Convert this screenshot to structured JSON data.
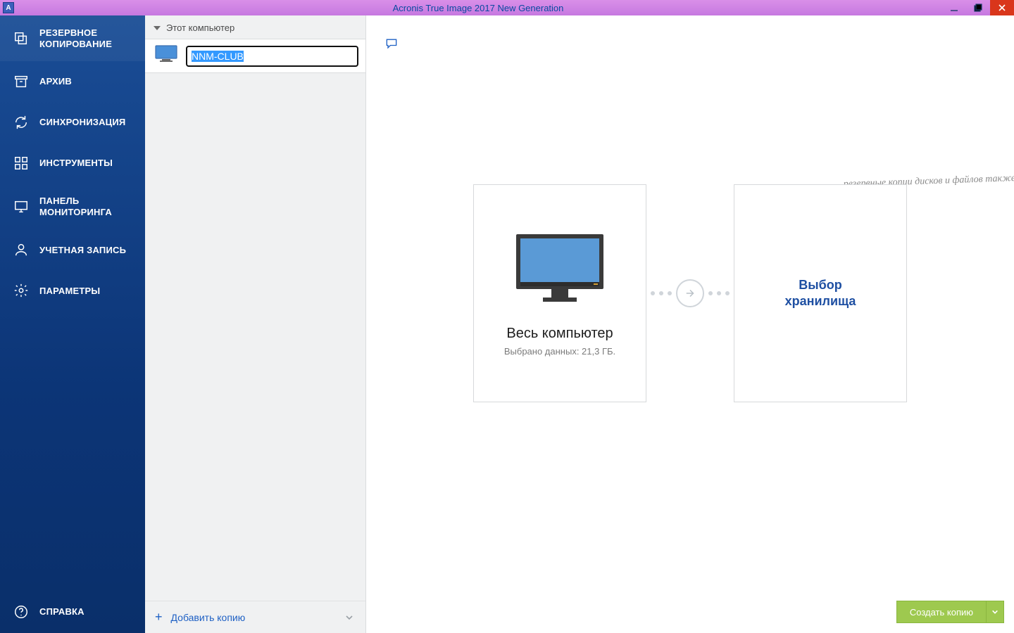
{
  "window": {
    "title": "Acronis True Image 2017 New Generation",
    "app_icon_letter": "A"
  },
  "nav": {
    "items": [
      {
        "label": "РЕЗЕРВНОЕ КОПИРОВАНИЕ"
      },
      {
        "label": "АРХИВ"
      },
      {
        "label": "СИНХРОНИЗАЦИЯ"
      },
      {
        "label": "ИНСТРУМЕНТЫ"
      },
      {
        "label": "ПАНЕЛЬ МОНИТОРИНГА"
      },
      {
        "label": "УЧЕТНАЯ ЗАПИСЬ"
      },
      {
        "label": "ПАРАМЕТРЫ"
      }
    ],
    "help_label": "СПРАВКА"
  },
  "list": {
    "header": "Этот компьютер",
    "items": [
      {
        "name": "NNM-CLUB"
      }
    ],
    "add_label": "Добавить копию"
  },
  "main": {
    "hand_note": "резервные копии дисков и файлов также доступны",
    "source_card": {
      "title": "Весь компьютер",
      "subtitle": "Выбрано данных: 21,3 ГБ."
    },
    "dest_card": {
      "line1": "Выбор",
      "line2": "хранилища"
    },
    "create_button": "Создать копию"
  }
}
